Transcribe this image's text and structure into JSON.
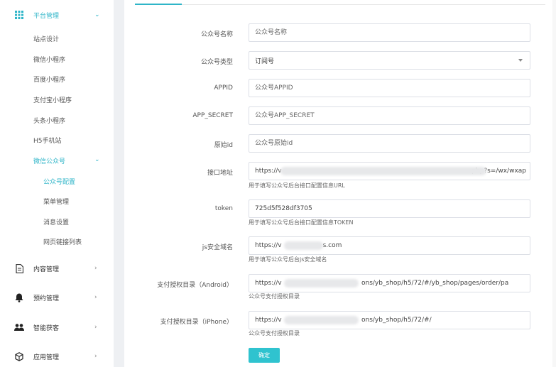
{
  "sidebar": {
    "platform": {
      "label": "平台管理",
      "icon": "grid-icon"
    },
    "platform_items": [
      "站点设计",
      "微信小程序",
      "百度小程序",
      "支付宝小程序",
      "头条小程序",
      "H5手机站"
    ],
    "wechat_group": {
      "label": "微信公众号"
    },
    "wechat_items": [
      "公众号配置",
      "菜单管理",
      "消息设置",
      "网页链接列表"
    ],
    "groups": [
      {
        "label": "内容管理",
        "icon": "document-icon"
      },
      {
        "label": "预约管理",
        "icon": "bell-icon"
      },
      {
        "label": "智能获客",
        "icon": "users-icon"
      },
      {
        "label": "应用管理",
        "icon": "cube-icon"
      }
    ]
  },
  "form": {
    "name": {
      "label": "公众号名称",
      "placeholder": "公众号名称"
    },
    "type": {
      "label": "公众号类型",
      "value": "订阅号"
    },
    "appid": {
      "label": "APPID",
      "placeholder": "公众号APPID"
    },
    "secret": {
      "label": "APP_SECRET",
      "placeholder": "公众号APP_SECRET"
    },
    "origin": {
      "label": "原始id",
      "placeholder": "公众号原始id"
    },
    "api": {
      "label": "接口地址",
      "value_start": "https://v",
      "value_end": ".php?s=/wx/wxap",
      "hint": "用于填写公众号后台接口配置信息URL"
    },
    "token": {
      "label": "token",
      "value": "725d5f528df3705",
      "hint": "用于填写公众号后台接口配置信息TOKEN"
    },
    "jsdomain": {
      "label": "js安全域名",
      "value_start": "https://v",
      "value_end": "s.com",
      "hint": "用于填写公众号后台js安全域名"
    },
    "pay_android": {
      "label": "支付授权目录（Android）",
      "value_start": "https://v",
      "value_end": "ons/yb_shop/h5/72/#/yb_shop/pages/order/pa",
      "hint": "公众号支付授权目录"
    },
    "pay_iphone": {
      "label": "支付授权目录（iPhone）",
      "value_start": "https://v",
      "value_end": "ons/yb_shop/h5/72/#/",
      "hint": "公众号支付授权目录"
    },
    "submit": "确定"
  },
  "colors": {
    "accent": "#2fb5c8",
    "button": "#2fc3cf"
  }
}
